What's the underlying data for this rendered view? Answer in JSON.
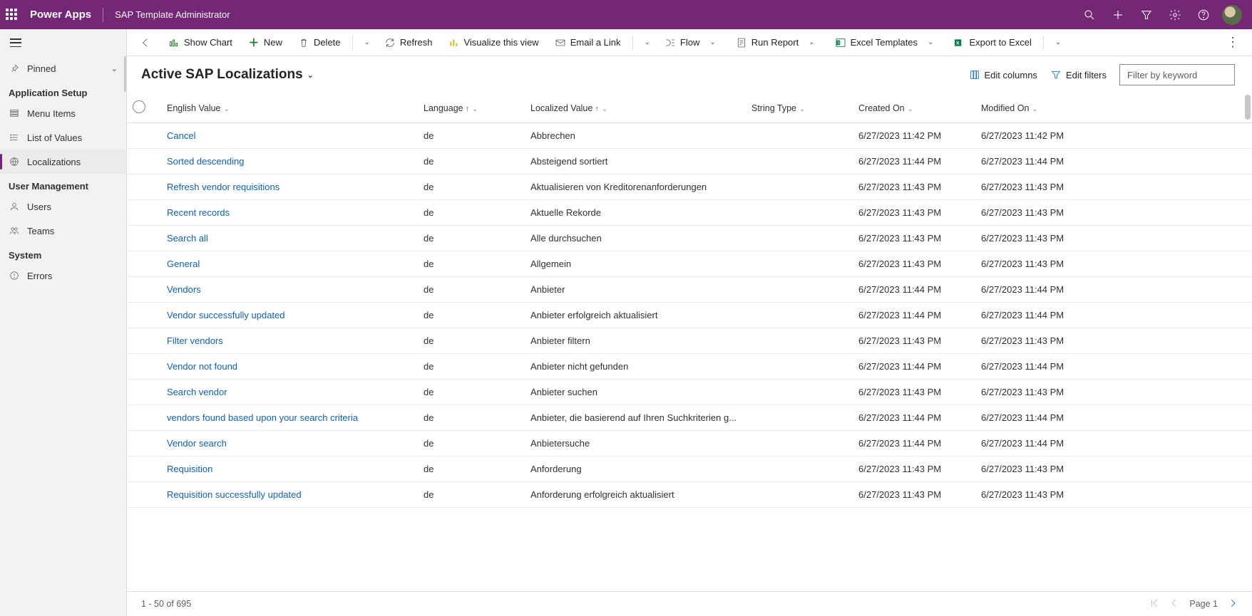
{
  "header": {
    "brand": "Power Apps",
    "app_title": "SAP Template Administrator"
  },
  "sidebar": {
    "pinned_label": "Pinned",
    "groups": [
      {
        "title": "Application Setup",
        "items": [
          {
            "icon": "menu-items",
            "label": "Menu Items",
            "active": false
          },
          {
            "icon": "list",
            "label": "List of Values",
            "active": false
          },
          {
            "icon": "globe",
            "label": "Localizations",
            "active": true
          }
        ]
      },
      {
        "title": "User Management",
        "items": [
          {
            "icon": "user",
            "label": "Users",
            "active": false
          },
          {
            "icon": "team",
            "label": "Teams",
            "active": false
          }
        ]
      },
      {
        "title": "System",
        "items": [
          {
            "icon": "error",
            "label": "Errors",
            "active": false
          }
        ]
      }
    ]
  },
  "commandbar": {
    "show_chart": "Show Chart",
    "new": "New",
    "delete": "Delete",
    "refresh": "Refresh",
    "visualize": "Visualize this view",
    "email": "Email a Link",
    "flow": "Flow",
    "run_report": "Run Report",
    "excel_templates": "Excel Templates",
    "export_excel": "Export to Excel"
  },
  "subheader": {
    "view_title": "Active SAP Localizations",
    "edit_columns": "Edit columns",
    "edit_filters": "Edit filters",
    "search_placeholder": "Filter by keyword"
  },
  "columns": {
    "english_value": "English Value",
    "language": "Language",
    "localized_value": "Localized Value",
    "string_type": "String Type",
    "created_on": "Created On",
    "modified_on": "Modified On"
  },
  "rows": [
    {
      "en": "Cancel",
      "lang": "de",
      "loc": "Abbrechen",
      "type": "",
      "created": "6/27/2023 11:42 PM",
      "modified": "6/27/2023 11:42 PM"
    },
    {
      "en": "Sorted descending",
      "lang": "de",
      "loc": "Absteigend sortiert",
      "type": "",
      "created": "6/27/2023 11:44 PM",
      "modified": "6/27/2023 11:44 PM"
    },
    {
      "en": "Refresh vendor requisitions",
      "lang": "de",
      "loc": "Aktualisieren von Kreditorenanforderungen",
      "type": "",
      "created": "6/27/2023 11:43 PM",
      "modified": "6/27/2023 11:43 PM"
    },
    {
      "en": "Recent records",
      "lang": "de",
      "loc": "Aktuelle Rekorde",
      "type": "",
      "created": "6/27/2023 11:43 PM",
      "modified": "6/27/2023 11:43 PM"
    },
    {
      "en": "Search all",
      "lang": "de",
      "loc": "Alle durchsuchen",
      "type": "",
      "created": "6/27/2023 11:43 PM",
      "modified": "6/27/2023 11:43 PM"
    },
    {
      "en": "General",
      "lang": "de",
      "loc": "Allgemein",
      "type": "",
      "created": "6/27/2023 11:43 PM",
      "modified": "6/27/2023 11:43 PM"
    },
    {
      "en": "Vendors",
      "lang": "de",
      "loc": "Anbieter",
      "type": "",
      "created": "6/27/2023 11:44 PM",
      "modified": "6/27/2023 11:44 PM"
    },
    {
      "en": "Vendor successfully updated",
      "lang": "de",
      "loc": "Anbieter erfolgreich aktualisiert",
      "type": "",
      "created": "6/27/2023 11:44 PM",
      "modified": "6/27/2023 11:44 PM"
    },
    {
      "en": "Filter vendors",
      "lang": "de",
      "loc": "Anbieter filtern",
      "type": "",
      "created": "6/27/2023 11:43 PM",
      "modified": "6/27/2023 11:43 PM"
    },
    {
      "en": "Vendor not found",
      "lang": "de",
      "loc": "Anbieter nicht gefunden",
      "type": "",
      "created": "6/27/2023 11:44 PM",
      "modified": "6/27/2023 11:44 PM"
    },
    {
      "en": "Search vendor",
      "lang": "de",
      "loc": "Anbieter suchen",
      "type": "",
      "created": "6/27/2023 11:43 PM",
      "modified": "6/27/2023 11:43 PM"
    },
    {
      "en": "vendors found based upon your search criteria",
      "lang": "de",
      "loc": "Anbieter, die basierend auf Ihren Suchkriterien g...",
      "type": "",
      "created": "6/27/2023 11:44 PM",
      "modified": "6/27/2023 11:44 PM"
    },
    {
      "en": "Vendor search",
      "lang": "de",
      "loc": "Anbietersuche",
      "type": "",
      "created": "6/27/2023 11:44 PM",
      "modified": "6/27/2023 11:44 PM"
    },
    {
      "en": "Requisition",
      "lang": "de",
      "loc": "Anforderung",
      "type": "",
      "created": "6/27/2023 11:43 PM",
      "modified": "6/27/2023 11:43 PM"
    },
    {
      "en": "Requisition successfully updated",
      "lang": "de",
      "loc": "Anforderung erfolgreich aktualisiert",
      "type": "",
      "created": "6/27/2023 11:43 PM",
      "modified": "6/27/2023 11:43 PM"
    }
  ],
  "footer": {
    "range": "1 - 50 of 695",
    "page_label": "Page 1"
  }
}
